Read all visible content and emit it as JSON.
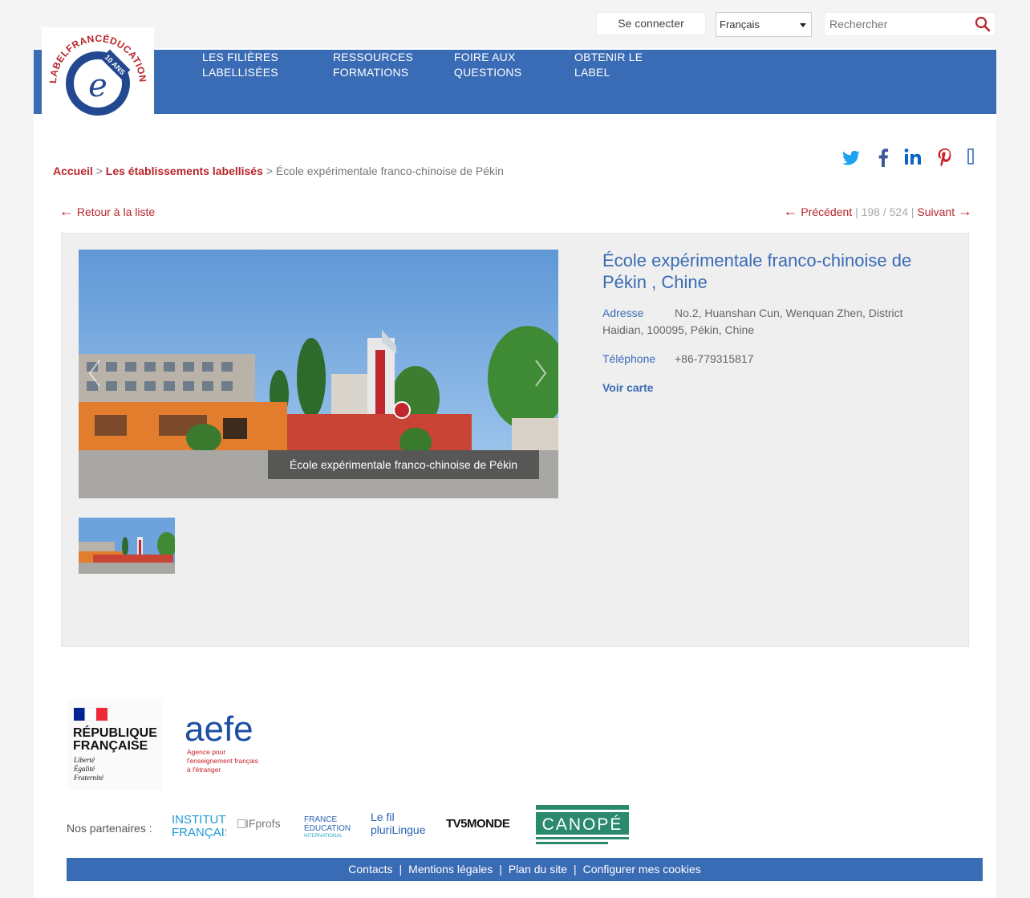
{
  "header": {
    "login_label": "Se connecter",
    "language": "Français",
    "search_placeholder": "Rechercher"
  },
  "nav": {
    "items": [
      {
        "label": "LES FILIÈRES\nLABELLISÉES"
      },
      {
        "label": "RESSOURCES\nFORMATIONS"
      },
      {
        "label": "FOIRE AUX\nQUESTIONS"
      },
      {
        "label": "OBTENIR LE\nLABEL"
      }
    ]
  },
  "logo": {
    "ring_text": "LABELFRANCÉDUCATION",
    "badge_text": "10 ANS"
  },
  "social": {
    "icons": [
      "twitter-icon",
      "facebook-icon",
      "linkedin-icon",
      "pinterest-icon",
      "more-icon"
    ]
  },
  "breadcrumb": {
    "home": "Accueil",
    "section": "Les établissements labellisés",
    "separator": ">",
    "current": "École expérimentale franco-chinoise de Pékin"
  },
  "navigation": {
    "back_label": "Retour à la liste",
    "prev_label": "Précédent",
    "position": "198 / 524",
    "next_label": "Suivant"
  },
  "gallery": {
    "caption": "École expérimentale franco-chinoise de Pékin",
    "thumbnail_count": 1
  },
  "school": {
    "title": "École expérimentale franco-chinoise de Pékin , Chine",
    "address_label": "Adresse",
    "address_line1": "No.2, Huanshan Cun, Wenquan Zhen, District",
    "address_line2": "Haidian, 100095, Pékin, Chine",
    "phone_label": "Téléphone",
    "phone": "+86-779315817",
    "map_label": "Voir carte"
  },
  "institutions": {
    "republique": [
      "RÉPUBLIQUE",
      "FRANÇAISE"
    ],
    "motto": [
      "Liberté",
      "Égalité",
      "Fraternité"
    ],
    "aefe": "aefe",
    "aefe_sub": [
      "Agence pour",
      "l'enseignement français",
      "à l'étranger"
    ]
  },
  "partners": {
    "label": "Nos partenaires :",
    "institut_francais": [
      "INSTITUT",
      "FRANÇAIS"
    ],
    "ifprofs": "IFprofs",
    "france_education": [
      "FRANCE",
      "ÉDUCATION",
      "INTERNATIONAL"
    ],
    "fil_plurilingue": [
      "Le fil",
      "pluriLingue"
    ],
    "tv5": "TV5MONDE",
    "canope": "CANOPÉ"
  },
  "footer": {
    "links": [
      "Contacts",
      "Mentions légales",
      "Plan du site",
      "Configurer mes cookies"
    ],
    "separator": "|"
  },
  "colors": {
    "brand_blue": "#3a6bb5",
    "link_red": "#b8252a",
    "panel_bg": "#efefef"
  }
}
